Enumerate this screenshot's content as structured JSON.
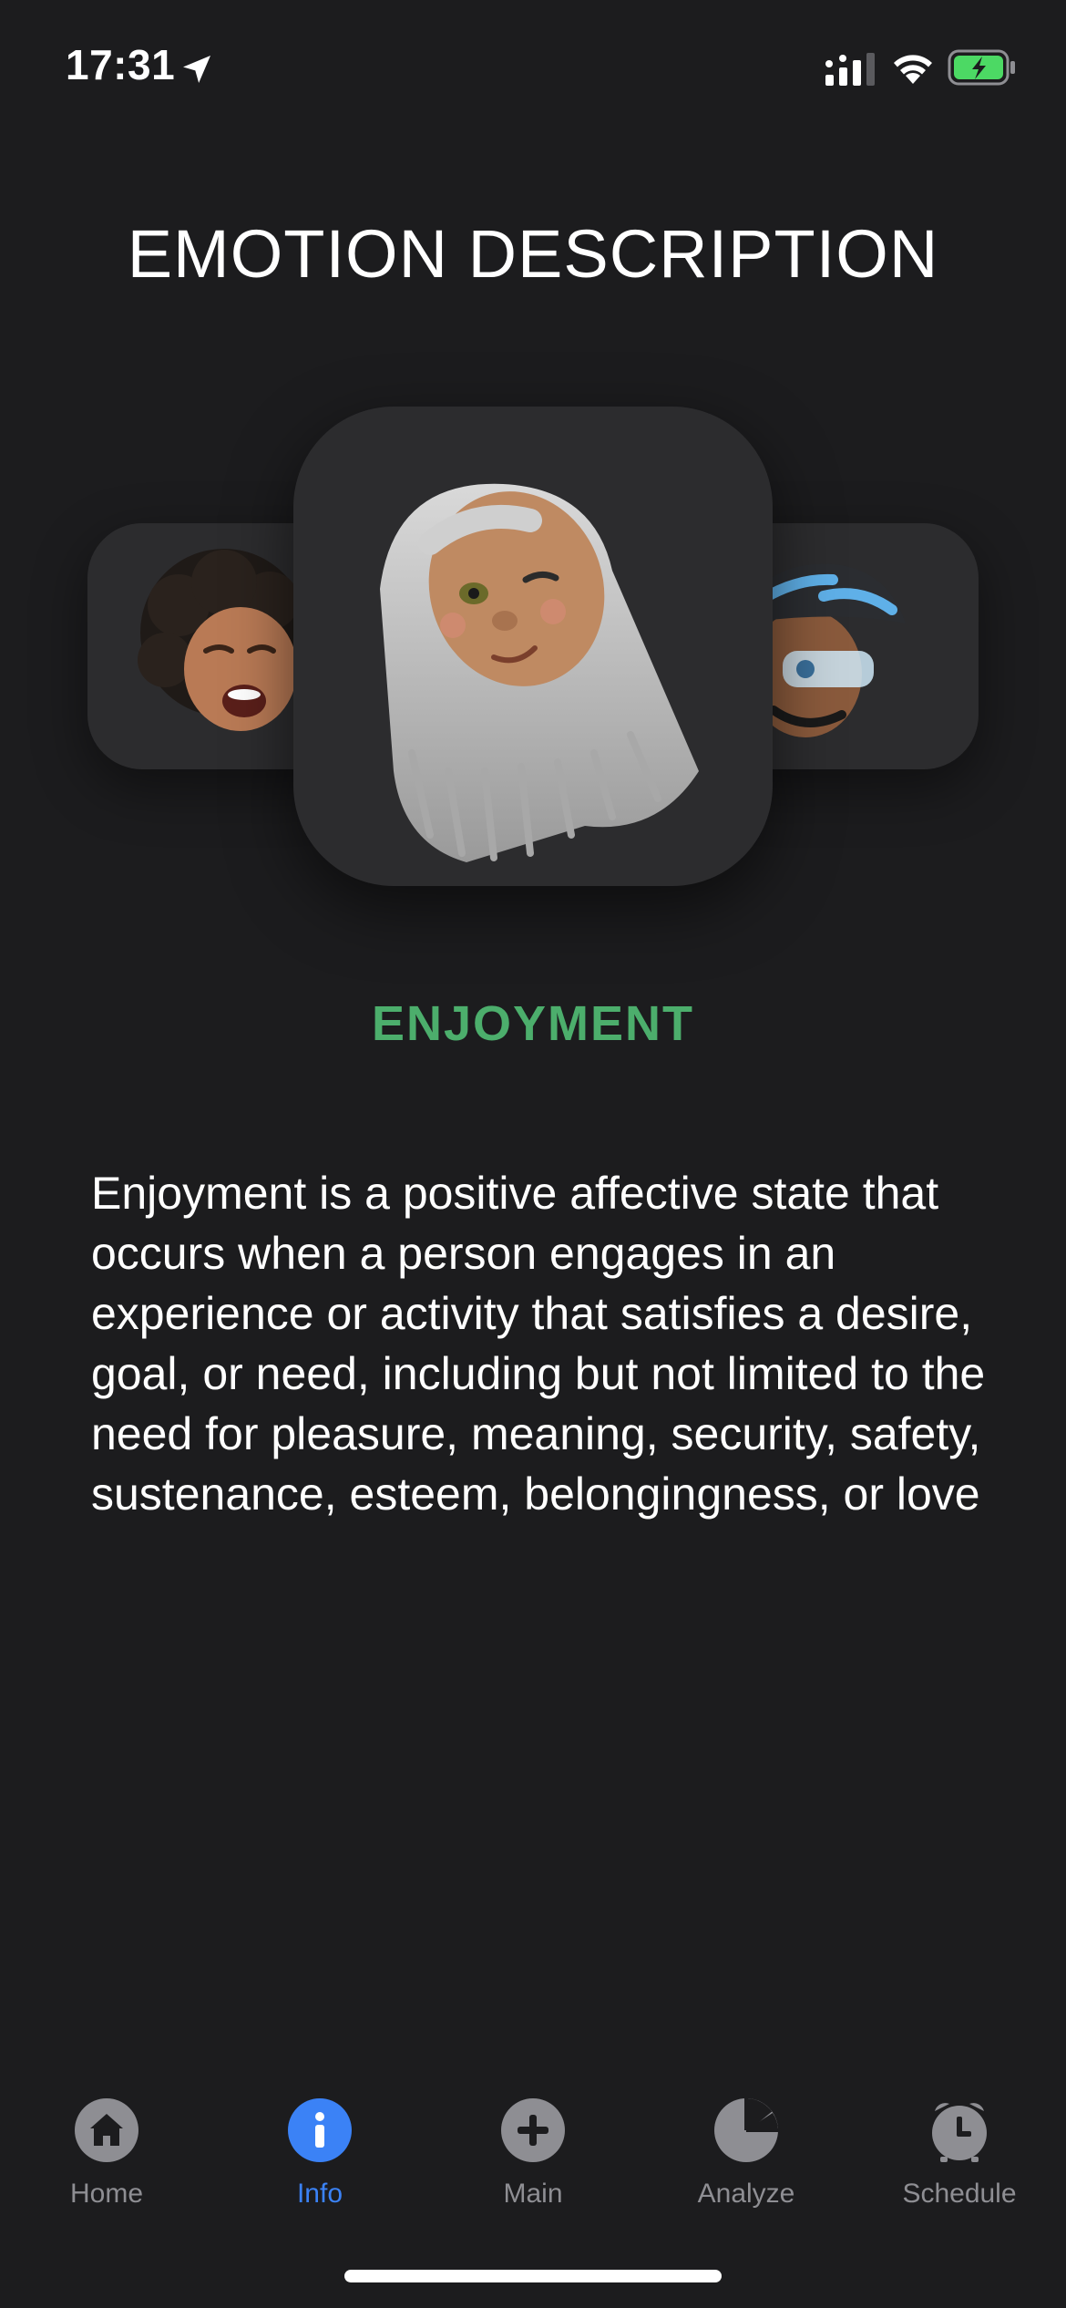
{
  "status_bar": {
    "time": "17:31",
    "icons": [
      "location-arrow-icon",
      "cellular-signal-icon",
      "wifi-icon",
      "battery-charging-icon"
    ],
    "battery_color": "#4cd964"
  },
  "header": {
    "title": "EMOTION DESCRIPTION"
  },
  "carousel": {
    "items": [
      {
        "icon": "laughing-curly-hair-memoji-avatar"
      },
      {
        "icon": "silver-hair-winking-memoji-avatar",
        "selected": true
      },
      {
        "icon": "cyclist-helmet-goggles-memoji-avatar"
      }
    ]
  },
  "emotion": {
    "name": "ENJOYMENT",
    "color": "#4cae6c",
    "description": "Enjoyment is a positive affective state that occurs when a person engages in an experience or activity that satisfies a desire, goal, or need, including but not limited to the need for pleasure, meaning, security, safety, sustenance, esteem, belongingness, or love"
  },
  "tab_bar": {
    "active_color": "#3b82f6",
    "inactive_color": "#8e8e93",
    "tabs": [
      {
        "label": "Home",
        "icon": "house-icon",
        "active": false
      },
      {
        "label": "Info",
        "icon": "info-icon",
        "active": true
      },
      {
        "label": "Main",
        "icon": "plus-icon",
        "active": false
      },
      {
        "label": "Analyze",
        "icon": "pie-chart-icon",
        "active": false
      },
      {
        "label": "Schedule",
        "icon": "alarm-clock-icon",
        "active": false
      }
    ]
  }
}
